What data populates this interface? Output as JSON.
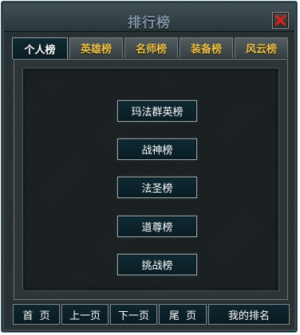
{
  "window": {
    "title": "排行榜"
  },
  "close": {
    "icon": "close-icon",
    "color": "#e0211b"
  },
  "tabs": [
    {
      "label": "个人榜",
      "active": true
    },
    {
      "label": "英雄榜",
      "active": false
    },
    {
      "label": "名师榜",
      "active": false
    },
    {
      "label": "装备榜",
      "active": false
    },
    {
      "label": "风云榜",
      "active": false
    }
  ],
  "menu": [
    {
      "label": "玛法群英榜"
    },
    {
      "label": "战神榜"
    },
    {
      "label": "法圣榜"
    },
    {
      "label": "道尊榜"
    },
    {
      "label": "挑战榜"
    }
  ],
  "footer": {
    "first": "首  页",
    "prev": "上一页",
    "next": "下一页",
    "last": "尾  页",
    "my_rank": "我的排名"
  },
  "colors": {
    "tab_text": "#f1c44a",
    "title_text": "#7f92a7",
    "panel_bg": "#1c2224"
  }
}
